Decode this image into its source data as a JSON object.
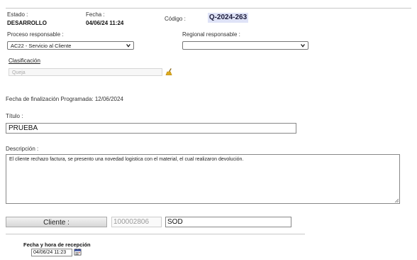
{
  "header": {
    "estado_label": "Estado :",
    "estado_value": "DESARROLLO",
    "fecha_label": "Fecha :",
    "fecha_value": "04/06/24 11:24",
    "codigo_label": "Código :",
    "codigo_value": "Q-2024-263"
  },
  "proceso": {
    "label": "Proceso responsable :",
    "selected": "AC22 - Servicio al Cliente"
  },
  "regional": {
    "label": "Regional responsable :",
    "selected": ""
  },
  "clasificacion": {
    "label": "Clasificación",
    "value": "Queja",
    "clear_icon": "broom-icon"
  },
  "finalizacion": {
    "text": "Fecha de finalización Programada: 12/06/2024"
  },
  "titulo": {
    "label": "Título :",
    "value": "PRUEBA"
  },
  "descripcion": {
    "label": "Descripción :",
    "value": "El cliente rechazo factura, se presento una novedad logistica con el material, el cual realizaron devolución."
  },
  "cliente": {
    "button_label": "Cliente :",
    "code": "100002806",
    "name": "SOD"
  },
  "recepcion": {
    "label": "Fecha y hora de recepción",
    "value": "04/06/24 11:23",
    "calendar_icon": "calendar-icon"
  }
}
